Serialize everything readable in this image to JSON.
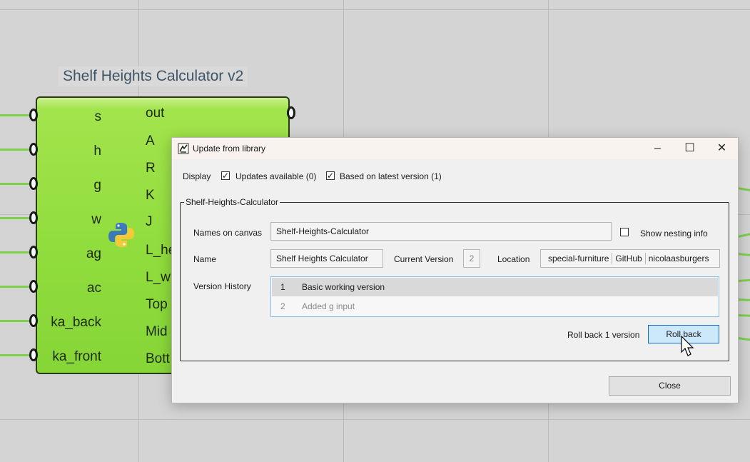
{
  "component": {
    "title": "Shelf Heights Calculator v2",
    "inputs": [
      "s",
      "h",
      "g",
      "w",
      "ag",
      "ac",
      "ka_back",
      "ka_front"
    ],
    "outputs": [
      "out",
      "A",
      "R",
      "K",
      "J",
      "L_he",
      "L_wi",
      "Top",
      "Mid",
      "Bott"
    ],
    "icon": "python-icon",
    "color": "#8fdc3c"
  },
  "dialog": {
    "title": "Update from library",
    "window_controls": {
      "minimize": "–",
      "maximize": "☐",
      "close": "✕"
    },
    "display": {
      "label": "Display",
      "updates_available": {
        "label": "Updates available (0)",
        "checked": true
      },
      "based_on_latest": {
        "label": "Based on latest version (1)",
        "checked": true
      }
    },
    "group_title": "Shelf-Heights-Calculator",
    "names_on_canvas": {
      "label": "Names on canvas",
      "value": "Shelf-Heights-Calculator"
    },
    "show_nesting": {
      "label": "Show nesting info",
      "checked": false
    },
    "name": {
      "label": "Name",
      "value": "Shelf Heights Calculator"
    },
    "current_version": {
      "label": "Current Version",
      "value": "2"
    },
    "location": {
      "label": "Location",
      "segments": [
        "special-furniture",
        "GitHub",
        "nicolaasburgers"
      ]
    },
    "version_history": {
      "label": "Version History",
      "rows": [
        {
          "num": "1",
          "desc": "Basic working version",
          "selected": true
        },
        {
          "num": "2",
          "desc": "Added g input",
          "selected": false
        }
      ]
    },
    "rollback_text": "Roll back 1 version",
    "rollback_button": "Roll back",
    "close_button": "Close",
    "accent_color": "#cce8fb"
  }
}
